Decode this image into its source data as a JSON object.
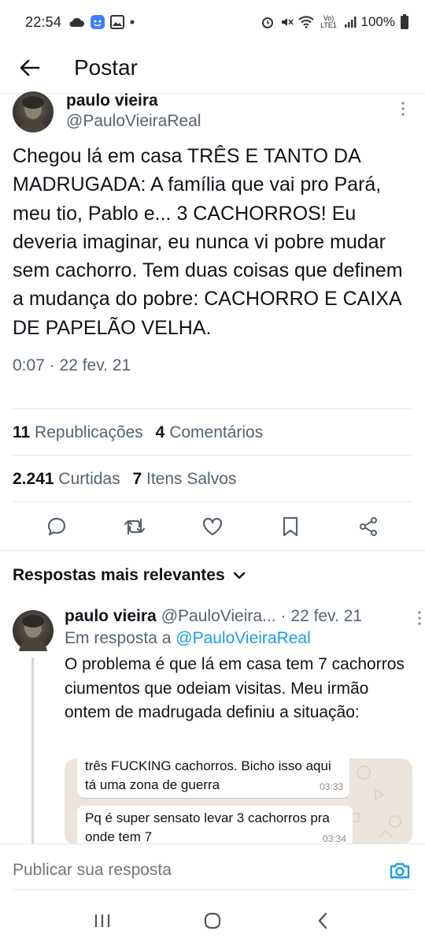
{
  "status_bar": {
    "time": "22:54",
    "battery": "100%",
    "network": "Vo) LTE1"
  },
  "header": {
    "title": "Postar"
  },
  "tweet": {
    "author_name": "paulo vieira",
    "author_handle": "@PauloVieiraReal",
    "text": "Chegou lá em casa TRÊS E TANTO DA MADRUGADA: A família que vai pro Pará, meu tio, Pablo e... 3 CACHORROS! Eu deveria imaginar, eu nunca vi pobre mudar sem cachorro. Tem duas coisas que definem a mudança do pobre: CACHORRO E CAIXA DE PAPELÃO VELHA.",
    "timestamp": "0:07 · 22 fev. 21",
    "stats": {
      "reposts_count": "11",
      "reposts_label": "Republicações",
      "comments_count": "4",
      "comments_label": "Comentários",
      "likes_count": "2.241",
      "likes_label": "Curtidas",
      "saves_count": "7",
      "saves_label": "Itens Salvos"
    }
  },
  "actions": {
    "icons": [
      "reply-icon",
      "repost-icon",
      "like-icon",
      "bookmark-icon",
      "share-icon"
    ]
  },
  "replies_section": {
    "label": "Respostas mais relevantes"
  },
  "reply": {
    "author_name": "paulo vieira",
    "author_handle": "@PauloVieira...",
    "date": "· 22 fev. 21",
    "reply_to_prefix": "Em resposta a",
    "reply_to_handle": "@PauloVieiraReal",
    "text": "O problema é que lá em casa tem 7 cachorros ciumentos que odeiam visitas. Meu irmão ontem de madrugada definiu a situação:",
    "image_messages": [
      {
        "text": "três FUCKING cachorros. Bicho isso aqui tá uma zona de guerra",
        "time": "03:33"
      },
      {
        "text": "Pq é super sensato levar 3 cachorros pra onde tem 7",
        "time": "03:34"
      }
    ]
  },
  "compose": {
    "placeholder": "Publicar sua resposta"
  },
  "colors": {
    "accent": "#1d9bf0",
    "text_primary": "#0f1419",
    "text_secondary": "#536471"
  }
}
